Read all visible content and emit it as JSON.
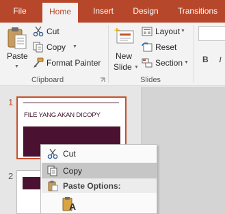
{
  "tabs": [
    "File",
    "Home",
    "Insert",
    "Design",
    "Transitions"
  ],
  "ribbon": {
    "clipboard": {
      "paste": "Paste",
      "cut": "Cut",
      "copy": "Copy",
      "format_painter": "Format Painter",
      "group_label": "Clipboard"
    },
    "slides": {
      "new_slide_line1": "New",
      "new_slide_line2": "Slide",
      "layout": "Layout",
      "reset": "Reset",
      "section": "Section",
      "group_label": "Slides"
    },
    "font": {
      "bold": "B",
      "italic": "I"
    }
  },
  "slides": [
    {
      "number": "1",
      "title": "FILE YANG AKAN DICOPY"
    },
    {
      "number": "2"
    }
  ],
  "context_menu": {
    "cut": "Cut",
    "copy": "Copy",
    "paste_options": "Paste Options:",
    "paste_option_glyph": "A"
  },
  "colors": {
    "accent": "#b7472a",
    "slide_block": "#4a1130",
    "selection_border": "#c5502c"
  }
}
